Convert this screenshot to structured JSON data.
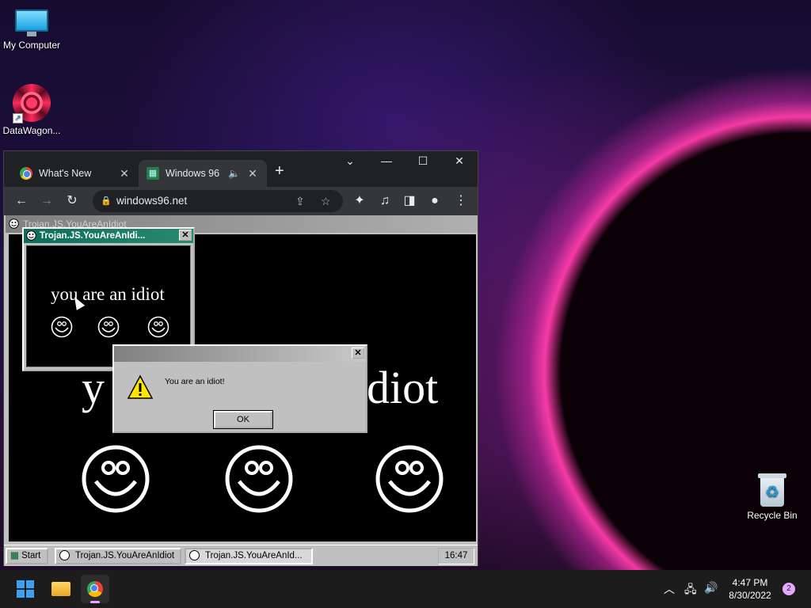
{
  "desktop": {
    "icons": [
      {
        "label": "My Computer"
      },
      {
        "label": "DataWagon..."
      },
      {
        "label": "Recycle Bin"
      }
    ]
  },
  "browser": {
    "tabs": [
      {
        "label": "What's New",
        "close": "✕"
      },
      {
        "label": "Windows 96",
        "close": "✕"
      }
    ],
    "new_tab": "+",
    "url": "windows96.net"
  },
  "w96": {
    "main_window_title": "Trojan.JS.YouAreAnIdiot",
    "main_text_left": "y",
    "main_text_right": "diot",
    "popup": {
      "title": "Trojan.JS.YouAreAnIdi...",
      "text": "you are an idiot"
    },
    "alert": {
      "message": "You are an idiot!",
      "ok_label": "OK"
    },
    "taskbar": {
      "start_label": "Start",
      "items": [
        {
          "label": "Trojan.JS.YouAreAnIdiot"
        },
        {
          "label": "Trojan.JS.YouAreAnId..."
        }
      ],
      "clock": "16:47"
    }
  },
  "taskbar": {
    "time": "4:47 PM",
    "date": "8/30/2022",
    "notification_count": "2"
  }
}
